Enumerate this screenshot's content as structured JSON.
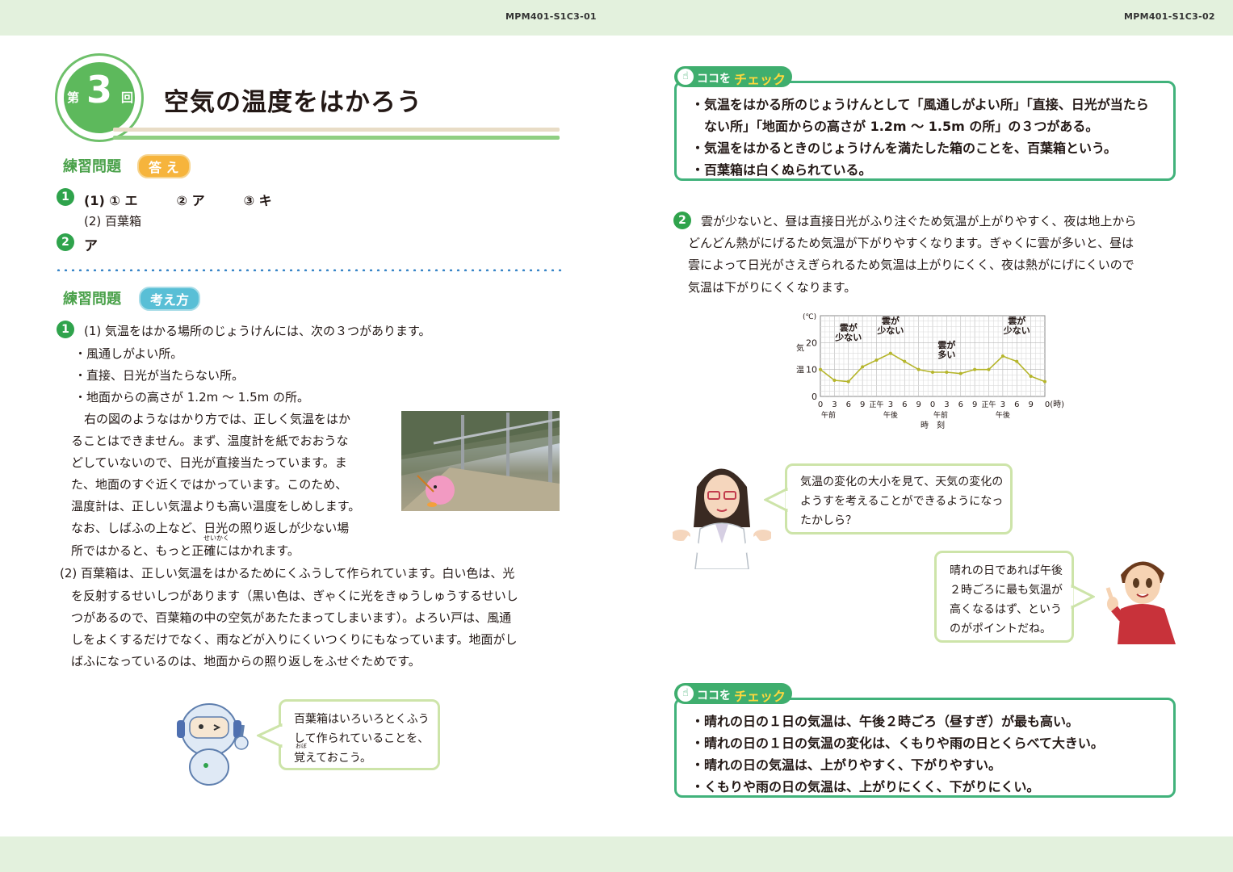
{
  "header": {
    "left_code": "MPM401-S1C3-01",
    "right_code": "MPM401-S1C3-02"
  },
  "title": {
    "dai": "第",
    "number": "3",
    "kai": "回",
    "text": "空気の温度をはかろう"
  },
  "answers_section": {
    "label": "練習問題",
    "badge": "答 え",
    "q1_num": "1",
    "q1_line1": "(1) ① エ　　　② ア　　　③ キ",
    "q1_line2": "(2) 百葉箱",
    "q2_num": "2",
    "q2_answer": "ア"
  },
  "thinking_section": {
    "label": "練習問題",
    "badge": "考え方",
    "q1_num": "1",
    "lines": [
      "(1) 気温をはかる場所のじょうけんには、次の３つがあります。",
      "・風通しがよい所。",
      "・直接、日光が当たらない所。",
      "・地面からの高さが 1.2m 〜 1.5m の所。",
      "右の図のようなはかり方では、正しく気温をはか",
      "ることはできません。まず、温度計を紙でおおうな",
      "どしていないので、日光が直接当たっています。ま",
      "た、地面のすぐ近くではかっています。このため、",
      "温度計は、正しい気温よりも高い温度をしめします。",
      "なお、しばふの上など、日光の照り返しが少ない場",
      "所ではかると、もっと正確にはかれます。"
    ],
    "ruby_seikaku": "せいかく",
    "q2_lines": [
      "(2) 百葉箱は、正しい気温をはかるためにくふうして作られています。白い色は、光",
      "を反射するせいしつがあります（黒い色は、ぎゃくに光をきゅうしゅうするせいし",
      "つがあるので、百葉箱の中の空気があたたまってしまいます）。よろい戸は、風通",
      "しをよくするだけでなく、雨などが入りにくいつくりにもなっています。地面がし",
      "ばふになっているのは、地面からの照り返しをふせぐためです。"
    ],
    "robot_bubble": [
      "百葉箱はいろいろとくふう",
      "して作られていることを、",
      "覚えておこう。"
    ],
    "ruby_oboe": "おぼ"
  },
  "check1": {
    "tab_coco": "ココを",
    "tab_check": "チェック",
    "lines": [
      "・気温をはかる所のじょうけんとして「風通しがよい所」「直接、日光が当たら",
      "　ない所」「地面からの高さが 1.2m 〜 1.5m の所」の３つがある。",
      "・気温をはかるときのじょうけんを満たした箱のことを、百葉箱という。",
      "・百葉箱は白くぬられている。"
    ]
  },
  "q2_explain": {
    "num": "2",
    "lines": [
      "雲が少ないと、昼は直接日光がふり注ぐため気温が上がりやすく、夜は地上から",
      "どんどん熱がにげるため気温が下がりやすくなります。ぎゃくに雲が多いと、昼は",
      "雲によって日光がさえぎられるため気温は上がりにくく、夜は熱がにげにくいので",
      "気温は下がりにくくなります。"
    ]
  },
  "chart_data": {
    "type": "line",
    "ylabel_unit": "(℃)",
    "ylabel": "気温",
    "ylim": [
      0,
      30
    ],
    "yticks": [
      "0",
      "10",
      "20"
    ],
    "x_tick_labels": [
      "0",
      "3",
      "6",
      "9",
      "正午",
      "3",
      "6",
      "9",
      "0",
      "3",
      "6",
      "9",
      "正午",
      "3",
      "6",
      "9",
      "0(時)"
    ],
    "x_sub_labels": [
      "午前",
      "午後",
      "午前",
      "午後"
    ],
    "xlabel": "時　刻",
    "x": [
      0,
      3,
      6,
      9,
      12,
      15,
      18,
      21,
      24,
      27,
      30,
      33,
      36,
      39,
      42,
      45,
      48
    ],
    "values": [
      10,
      6,
      5.5,
      11,
      13.5,
      16,
      13,
      10,
      9,
      9,
      8.5,
      10,
      10,
      15,
      13,
      7.5,
      5.5
    ],
    "annotations": [
      {
        "text": [
          "雲が",
          "少ない"
        ]
      },
      {
        "text": [
          "雲が",
          "少ない"
        ]
      },
      {
        "text": [
          "雲が",
          "多い"
        ]
      },
      {
        "text": [
          "雲が",
          "少ない"
        ]
      }
    ],
    "grid": true,
    "line_color": "#b5b52a"
  },
  "teacher_bubble": [
    "気温の変化の大小を見て、天気の変化の",
    "ようすを考えることができるようになっ",
    "たかしら？"
  ],
  "boy_bubble": [
    "晴れの日であれば午後",
    "２時ごろに最も気温が",
    "高くなるはず、という",
    "のがポイントだね。"
  ],
  "check2": {
    "tab_coco": "ココを",
    "tab_check": "チェック",
    "lines": [
      "・晴れの日の１日の気温は、午後２時ごろ（昼すぎ）が最も高い。",
      "・晴れの日の１日の気温の変化は、くもりや雨の日とくらべて大きい。",
      "・晴れの日の気温は、上がりやすく、下がりやすい。",
      "・くもりや雨の日の気温は、上がりにくく、下がりにくい。"
    ]
  },
  "colors": {
    "green": "#5db95c",
    "check_green": "#41b27b",
    "orange": "#f6b43c",
    "cyan": "#59bfd6",
    "band": "#e3f1dd"
  }
}
